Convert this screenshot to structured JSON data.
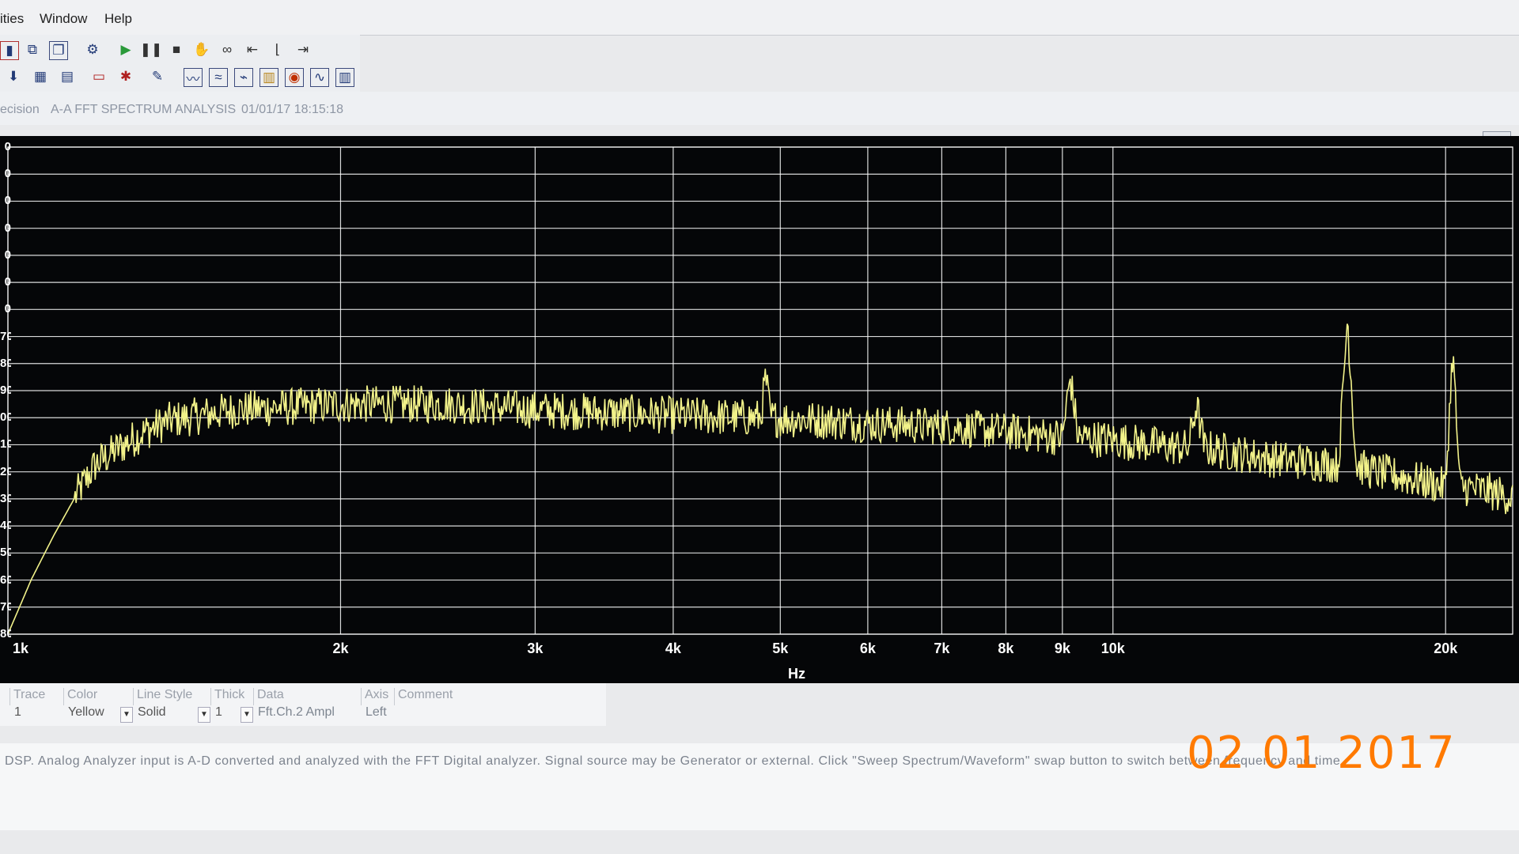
{
  "menu": {
    "items": [
      "ities",
      "Window",
      "Help"
    ]
  },
  "toolbar_row1_icons": [
    "panel-icon",
    "copy-traces-icon",
    "duplicate-icon",
    "settings-icon",
    "play-icon",
    "pause-icon",
    "stop-icon",
    "hand-icon",
    "binoculars-icon",
    "step-left-icon",
    "bracket-icon",
    "step-right-icon"
  ],
  "toolbar_row2_icons": [
    "download-icon",
    "grid-icon",
    "table-icon",
    "meter-icon",
    "analyzer-icon",
    "notes-icon",
    "sweep1-icon",
    "sweep2-icon",
    "sweep3-icon",
    "bars-icon",
    "fft-icon",
    "waveform-icon",
    "columns-icon"
  ],
  "window_title": {
    "prefix": "ecision",
    "title": "A-A FFT SPECTRUM ANALYSIS",
    "timestamp": "01/01/17 18:15:18"
  },
  "graph": {
    "y_tick_labels": [
      "0",
      "0",
      "0",
      "0",
      "0",
      "0",
      "0",
      "70",
      "80",
      "90",
      "00",
      "10",
      "20",
      "30",
      "40",
      "50",
      "60",
      "70",
      "80"
    ],
    "x_axis_title": "Hz",
    "colors": {
      "background": "#050608",
      "grid": "#ffffff",
      "trace": "#f2f28a"
    }
  },
  "chart_data": {
    "type": "line",
    "xlabel": "Hz",
    "x_scale": "log",
    "xlim": [
      1000,
      23000
    ],
    "x_tick_labels": [
      "1k",
      "2k",
      "3k",
      "4k",
      "5k",
      "6k",
      "7k",
      "8k",
      "9k",
      "10k",
      "20k"
    ],
    "x_ticks": [
      1000,
      2000,
      3000,
      4000,
      5000,
      6000,
      7000,
      8000,
      9000,
      10000,
      20000
    ],
    "series": [
      {
        "name": "",
        "color": "#f2f28a",
        "x": [
          1000,
          1050,
          1100,
          1150,
          1200,
          1260,
          1330,
          1400,
          1500,
          1600,
          1800,
          2000,
          2500,
          3000,
          3500,
          4000,
          4800,
          4850,
          4900,
          5500,
          6000,
          7000,
          8000,
          8500,
          9000,
          9150,
          9300,
          10000,
          11000,
          11700,
          11900,
          12100,
          13000,
          14000,
          15000,
          16000,
          16300,
          16600,
          17000,
          18000,
          19000,
          20000,
          20300,
          20600,
          22000,
          23000
        ],
        "y": [
          -182,
          -172,
          -164,
          -157,
          -151,
          -148,
          -145,
          -143,
          -142,
          -141,
          -140.5,
          -140,
          -140,
          -141,
          -141.5,
          -142,
          -142.5,
          -135,
          -142.5,
          -143,
          -143.5,
          -144,
          -145,
          -145.5,
          -146,
          -135,
          -146,
          -146.5,
          -147.5,
          -148,
          -140,
          -148,
          -149,
          -150,
          -150.5,
          -151,
          -124,
          -151,
          -152,
          -153,
          -154,
          -155,
          -130,
          -155,
          -156,
          -157
        ]
      }
    ]
  },
  "trace_table": {
    "headers": [
      "Trace",
      "Color",
      "Line Style",
      "Thick",
      "Data",
      "Axis",
      "Comment"
    ],
    "row": {
      "trace": "1",
      "color": "Yellow",
      "line_style": "Solid",
      "thick": "1",
      "data": "Fft.Ch.2 Ampl",
      "axis": "Left",
      "comment": ""
    }
  },
  "status_text": "DSP.  Analog Analyzer input is A-D converted and analyzed with the FFT Digital analyzer.  Signal source may be Generator or external.  Click \"Sweep Spectrum/Waveform\" swap button to switch between frequency and time",
  "date_stamp": "02 01 2017"
}
